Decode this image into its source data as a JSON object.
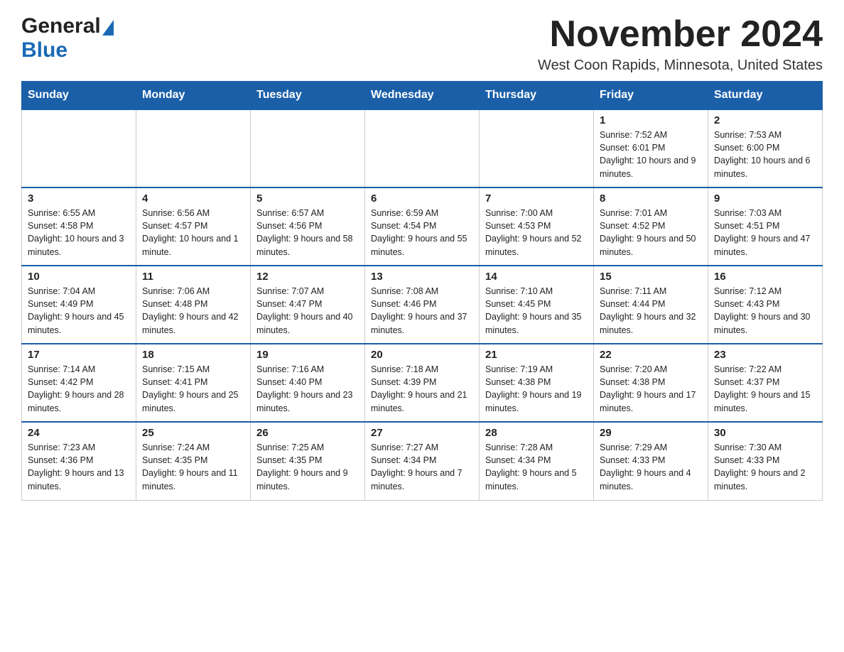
{
  "header": {
    "logo_general": "General",
    "logo_blue": "Blue",
    "month_title": "November 2024",
    "location": "West Coon Rapids, Minnesota, United States"
  },
  "calendar": {
    "days_of_week": [
      "Sunday",
      "Monday",
      "Tuesday",
      "Wednesday",
      "Thursday",
      "Friday",
      "Saturday"
    ],
    "weeks": [
      [
        {
          "day": "",
          "info": ""
        },
        {
          "day": "",
          "info": ""
        },
        {
          "day": "",
          "info": ""
        },
        {
          "day": "",
          "info": ""
        },
        {
          "day": "",
          "info": ""
        },
        {
          "day": "1",
          "info": "Sunrise: 7:52 AM\nSunset: 6:01 PM\nDaylight: 10 hours and 9 minutes."
        },
        {
          "day": "2",
          "info": "Sunrise: 7:53 AM\nSunset: 6:00 PM\nDaylight: 10 hours and 6 minutes."
        }
      ],
      [
        {
          "day": "3",
          "info": "Sunrise: 6:55 AM\nSunset: 4:58 PM\nDaylight: 10 hours and 3 minutes."
        },
        {
          "day": "4",
          "info": "Sunrise: 6:56 AM\nSunset: 4:57 PM\nDaylight: 10 hours and 1 minute."
        },
        {
          "day": "5",
          "info": "Sunrise: 6:57 AM\nSunset: 4:56 PM\nDaylight: 9 hours and 58 minutes."
        },
        {
          "day": "6",
          "info": "Sunrise: 6:59 AM\nSunset: 4:54 PM\nDaylight: 9 hours and 55 minutes."
        },
        {
          "day": "7",
          "info": "Sunrise: 7:00 AM\nSunset: 4:53 PM\nDaylight: 9 hours and 52 minutes."
        },
        {
          "day": "8",
          "info": "Sunrise: 7:01 AM\nSunset: 4:52 PM\nDaylight: 9 hours and 50 minutes."
        },
        {
          "day": "9",
          "info": "Sunrise: 7:03 AM\nSunset: 4:51 PM\nDaylight: 9 hours and 47 minutes."
        }
      ],
      [
        {
          "day": "10",
          "info": "Sunrise: 7:04 AM\nSunset: 4:49 PM\nDaylight: 9 hours and 45 minutes."
        },
        {
          "day": "11",
          "info": "Sunrise: 7:06 AM\nSunset: 4:48 PM\nDaylight: 9 hours and 42 minutes."
        },
        {
          "day": "12",
          "info": "Sunrise: 7:07 AM\nSunset: 4:47 PM\nDaylight: 9 hours and 40 minutes."
        },
        {
          "day": "13",
          "info": "Sunrise: 7:08 AM\nSunset: 4:46 PM\nDaylight: 9 hours and 37 minutes."
        },
        {
          "day": "14",
          "info": "Sunrise: 7:10 AM\nSunset: 4:45 PM\nDaylight: 9 hours and 35 minutes."
        },
        {
          "day": "15",
          "info": "Sunrise: 7:11 AM\nSunset: 4:44 PM\nDaylight: 9 hours and 32 minutes."
        },
        {
          "day": "16",
          "info": "Sunrise: 7:12 AM\nSunset: 4:43 PM\nDaylight: 9 hours and 30 minutes."
        }
      ],
      [
        {
          "day": "17",
          "info": "Sunrise: 7:14 AM\nSunset: 4:42 PM\nDaylight: 9 hours and 28 minutes."
        },
        {
          "day": "18",
          "info": "Sunrise: 7:15 AM\nSunset: 4:41 PM\nDaylight: 9 hours and 25 minutes."
        },
        {
          "day": "19",
          "info": "Sunrise: 7:16 AM\nSunset: 4:40 PM\nDaylight: 9 hours and 23 minutes."
        },
        {
          "day": "20",
          "info": "Sunrise: 7:18 AM\nSunset: 4:39 PM\nDaylight: 9 hours and 21 minutes."
        },
        {
          "day": "21",
          "info": "Sunrise: 7:19 AM\nSunset: 4:38 PM\nDaylight: 9 hours and 19 minutes."
        },
        {
          "day": "22",
          "info": "Sunrise: 7:20 AM\nSunset: 4:38 PM\nDaylight: 9 hours and 17 minutes."
        },
        {
          "day": "23",
          "info": "Sunrise: 7:22 AM\nSunset: 4:37 PM\nDaylight: 9 hours and 15 minutes."
        }
      ],
      [
        {
          "day": "24",
          "info": "Sunrise: 7:23 AM\nSunset: 4:36 PM\nDaylight: 9 hours and 13 minutes."
        },
        {
          "day": "25",
          "info": "Sunrise: 7:24 AM\nSunset: 4:35 PM\nDaylight: 9 hours and 11 minutes."
        },
        {
          "day": "26",
          "info": "Sunrise: 7:25 AM\nSunset: 4:35 PM\nDaylight: 9 hours and 9 minutes."
        },
        {
          "day": "27",
          "info": "Sunrise: 7:27 AM\nSunset: 4:34 PM\nDaylight: 9 hours and 7 minutes."
        },
        {
          "day": "28",
          "info": "Sunrise: 7:28 AM\nSunset: 4:34 PM\nDaylight: 9 hours and 5 minutes."
        },
        {
          "day": "29",
          "info": "Sunrise: 7:29 AM\nSunset: 4:33 PM\nDaylight: 9 hours and 4 minutes."
        },
        {
          "day": "30",
          "info": "Sunrise: 7:30 AM\nSunset: 4:33 PM\nDaylight: 9 hours and 2 minutes."
        }
      ]
    ]
  }
}
